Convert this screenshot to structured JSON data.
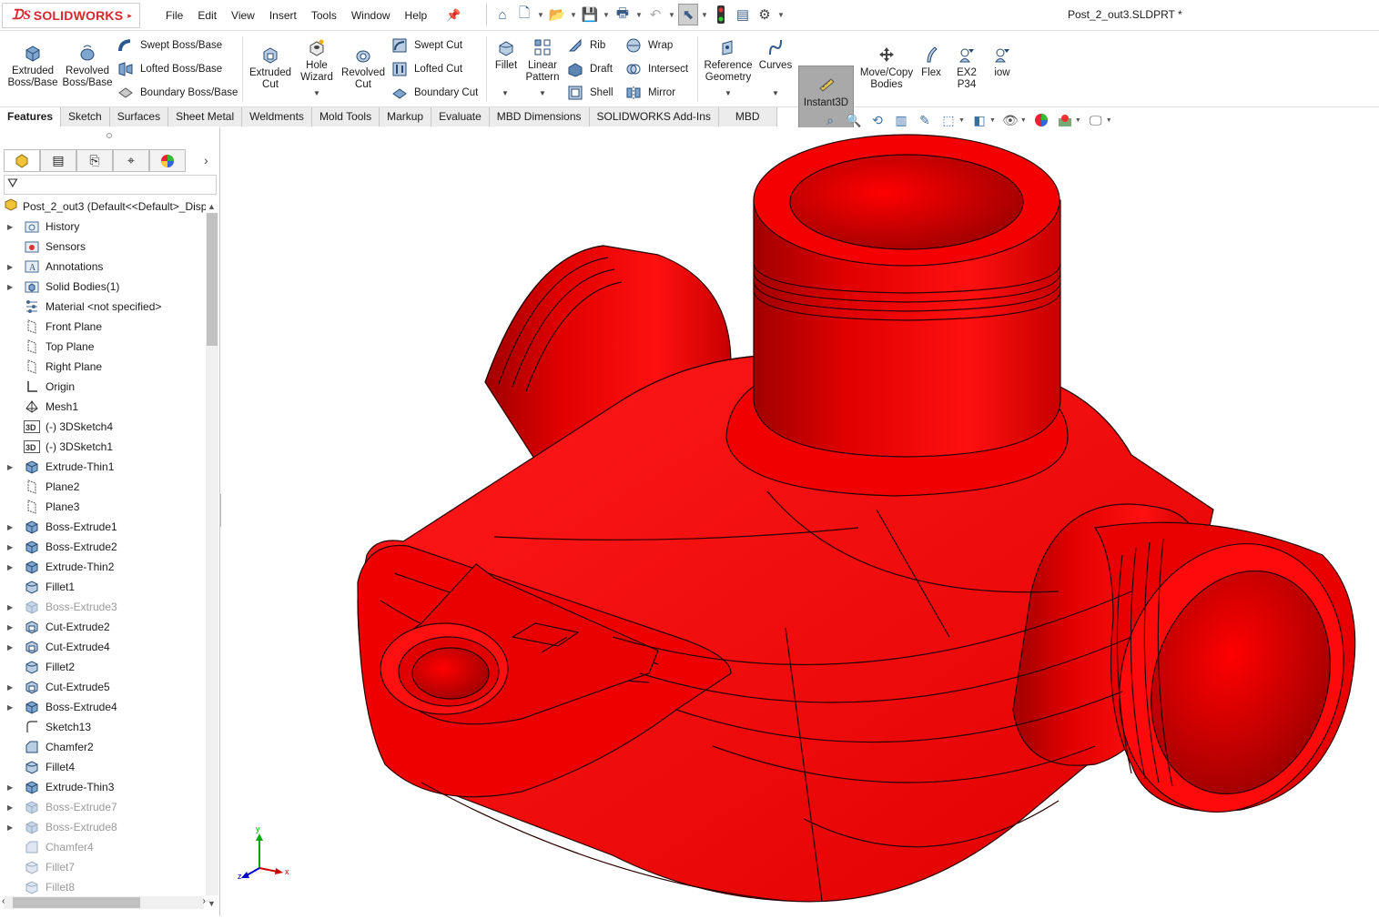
{
  "app": {
    "brand": "SOLIDWORKS",
    "document_title": "Post_2_out3.SLDPRT *"
  },
  "menu": [
    "File",
    "Edit",
    "View",
    "Insert",
    "Tools",
    "Window",
    "Help"
  ],
  "ribbon": {
    "extruded_boss": "Extruded Boss/Base",
    "revolved_boss": "Revolved Boss/Base",
    "swept_boss": "Swept Boss/Base",
    "lofted_boss": "Lofted Boss/Base",
    "boundary_boss": "Boundary Boss/Base",
    "extruded_cut": "Extruded Cut",
    "hole_wizard": "Hole Wizard",
    "revolved_cut": "Revolved Cut",
    "swept_cut": "Swept Cut",
    "lofted_cut": "Lofted Cut",
    "boundary_cut": "Boundary Cut",
    "fillet": "Fillet",
    "linear_pattern": "Linear Pattern",
    "rib": "Rib",
    "draft": "Draft",
    "shell": "Shell",
    "wrap": "Wrap",
    "intersect": "Intersect",
    "mirror": "Mirror",
    "reference_geometry": "Reference Geometry",
    "curves": "Curves",
    "instant3d": "Instant3D",
    "move_copy": "Move/Copy Bodies",
    "flex": "Flex",
    "ex2p34": "EX2 P34",
    "iow": "iow"
  },
  "tabs": [
    "Features",
    "Sketch",
    "Surfaces",
    "Sheet Metal",
    "Weldments",
    "Mold Tools",
    "Markup",
    "Evaluate",
    "MBD Dimensions",
    "SOLIDWORKS Add-Ins",
    "MBD"
  ],
  "active_tab": "Features",
  "tree": {
    "root": "Post_2_out3  (Default<<Default>_Display State 1>)",
    "items": [
      {
        "label": "History",
        "icon": "history-folder-icon",
        "expand": true,
        "sup": false
      },
      {
        "label": "Sensors",
        "icon": "sensors-icon",
        "expand": false,
        "sup": false
      },
      {
        "label": "Annotations",
        "icon": "annotations-icon",
        "expand": true,
        "sup": false
      },
      {
        "label": "Solid Bodies(1)",
        "icon": "solid-bodies-icon",
        "expand": true,
        "sup": false
      },
      {
        "label": "Material <not specified>",
        "icon": "material-icon",
        "expand": false,
        "sup": false
      },
      {
        "label": "Front Plane",
        "icon": "plane-icon",
        "expand": false,
        "sup": false
      },
      {
        "label": "Top Plane",
        "icon": "plane-icon",
        "expand": false,
        "sup": false
      },
      {
        "label": "Right Plane",
        "icon": "plane-icon",
        "expand": false,
        "sup": false
      },
      {
        "label": "Origin",
        "icon": "origin-icon",
        "expand": false,
        "sup": false
      },
      {
        "label": "Mesh1",
        "icon": "mesh-icon",
        "expand": false,
        "sup": false
      },
      {
        "label": "(-) 3DSketch4",
        "icon": "3d-sketch-icon",
        "expand": false,
        "sup": false
      },
      {
        "label": "(-) 3DSketch1",
        "icon": "3d-sketch-icon",
        "expand": false,
        "sup": false
      },
      {
        "label": "Extrude-Thin1",
        "icon": "extrude-icon",
        "expand": true,
        "sup": false
      },
      {
        "label": "Plane2",
        "icon": "plane-icon",
        "expand": false,
        "sup": false
      },
      {
        "label": "Plane3",
        "icon": "plane-icon",
        "expand": false,
        "sup": false
      },
      {
        "label": "Boss-Extrude1",
        "icon": "extrude-icon",
        "expand": true,
        "sup": false
      },
      {
        "label": "Boss-Extrude2",
        "icon": "extrude-icon",
        "expand": true,
        "sup": false
      },
      {
        "label": "Extrude-Thin2",
        "icon": "extrude-icon",
        "expand": true,
        "sup": false
      },
      {
        "label": "Fillet1",
        "icon": "fillet-icon",
        "expand": false,
        "sup": false
      },
      {
        "label": "Boss-Extrude3",
        "icon": "extrude-icon",
        "expand": true,
        "sup": true
      },
      {
        "label": "Cut-Extrude2",
        "icon": "cut-extrude-icon",
        "expand": true,
        "sup": false
      },
      {
        "label": "Cut-Extrude4",
        "icon": "cut-extrude-icon",
        "expand": true,
        "sup": false
      },
      {
        "label": "Fillet2",
        "icon": "fillet-icon",
        "expand": false,
        "sup": false
      },
      {
        "label": "Cut-Extrude5",
        "icon": "cut-extrude-icon",
        "expand": true,
        "sup": false
      },
      {
        "label": "Boss-Extrude4",
        "icon": "extrude-icon",
        "expand": true,
        "sup": false
      },
      {
        "label": "Sketch13",
        "icon": "sketch-icon",
        "expand": false,
        "sup": false
      },
      {
        "label": "Chamfer2",
        "icon": "chamfer-icon",
        "expand": false,
        "sup": false
      },
      {
        "label": "Fillet4",
        "icon": "fillet-icon",
        "expand": false,
        "sup": false
      },
      {
        "label": "Extrude-Thin3",
        "icon": "extrude-icon",
        "expand": true,
        "sup": false
      },
      {
        "label": "Boss-Extrude7",
        "icon": "extrude-icon",
        "expand": true,
        "sup": true
      },
      {
        "label": "Boss-Extrude8",
        "icon": "extrude-icon",
        "expand": true,
        "sup": true
      },
      {
        "label": "Chamfer4",
        "icon": "chamfer-icon",
        "expand": false,
        "sup": true
      },
      {
        "label": "Fillet7",
        "icon": "fillet-icon",
        "expand": false,
        "sup": true
      },
      {
        "label": "Fillet8",
        "icon": "fillet-icon",
        "expand": false,
        "sup": true
      }
    ]
  },
  "triad": {
    "x": "x",
    "y": "y",
    "z": "z"
  },
  "colors": {
    "part": "#ff0000",
    "part_shade": "#b80000",
    "brand": "#d9272e",
    "accent": "#2f74c0"
  }
}
